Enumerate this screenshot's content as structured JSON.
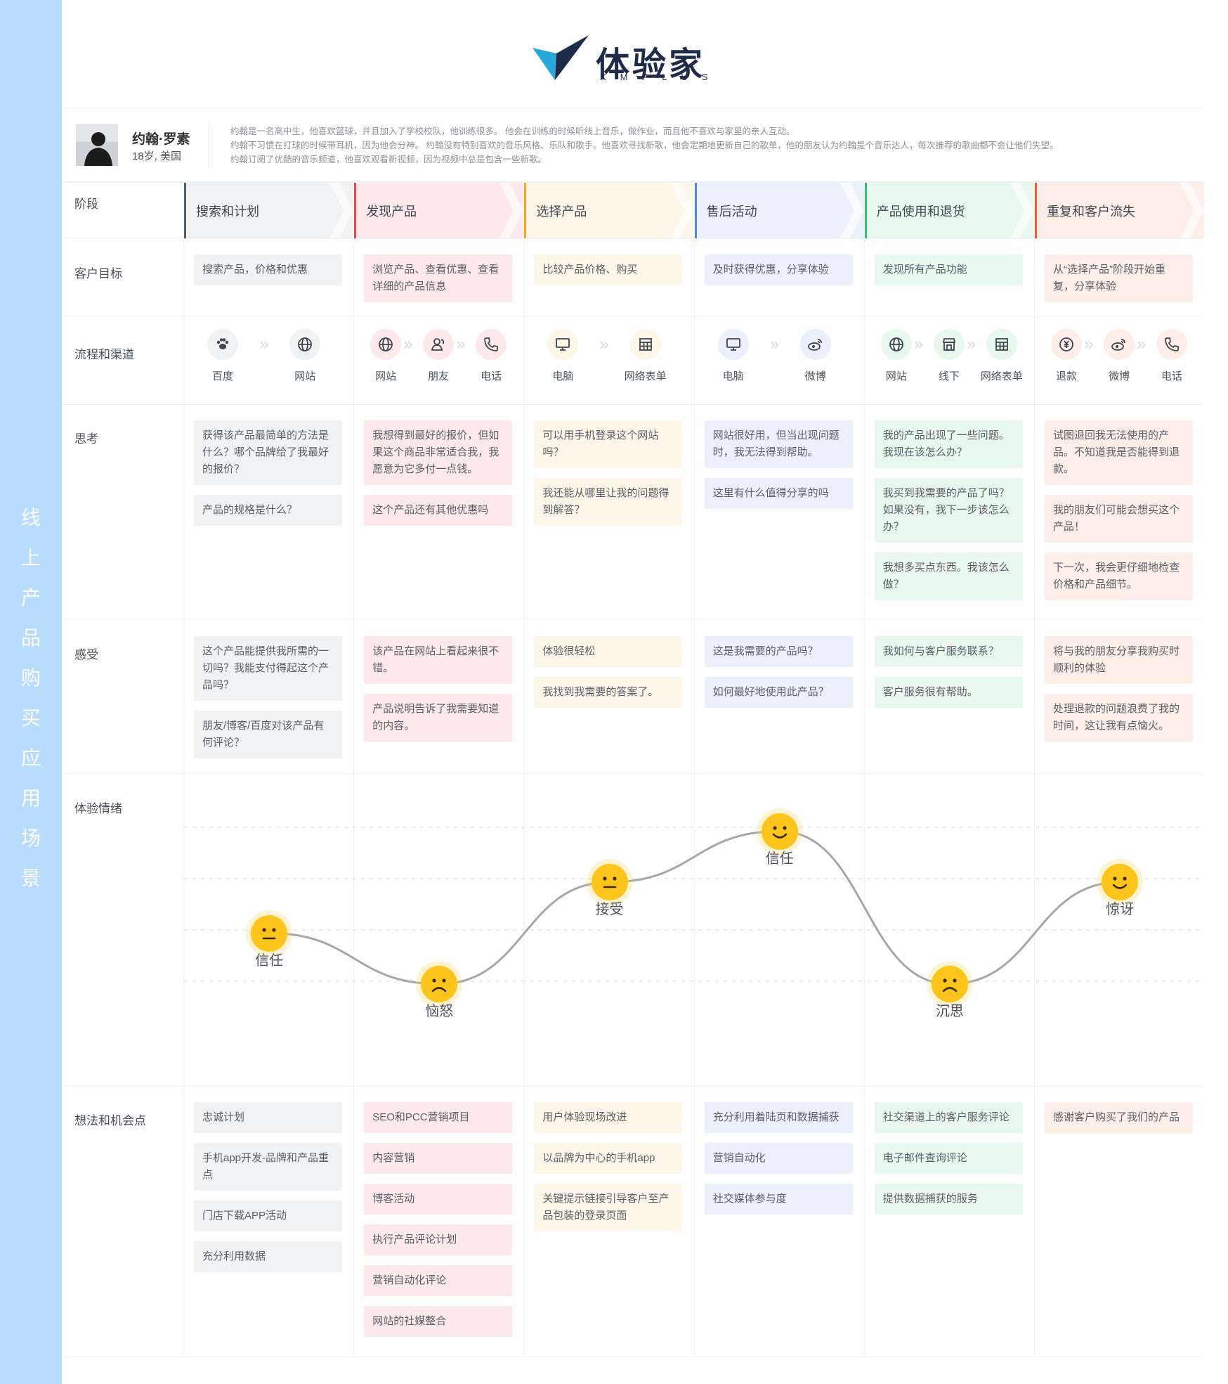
{
  "sidebar_title": [
    "线",
    "上",
    "产",
    "品",
    "购",
    "买",
    "应",
    "用",
    "场",
    "景"
  ],
  "logo": {
    "cn": "体验家",
    "en": "XMPLUS"
  },
  "persona": {
    "name": "约翰·罗素",
    "age": "18岁, 美国",
    "bio": [
      "约翰是一名高中生，他喜欢篮球，并且加入了学校校队，他训练很多。 他会在训练的时候听线上音乐，做作业，而且他不喜欢与家里的亲人互动。",
      "约翰不习惯在打球的时候带耳机，因为他会分神。 约翰没有特别喜欢的音乐风格、乐队和歌手。他喜欢寻找新歌，他会定期地更新自己的歌单，他的朋友认为约翰是个音乐达人，每次推荐的歌曲都不会让他们失望。",
      "约翰订阅了优酷的音乐频道，他喜欢观看新视频，因为视频中总是包含一些新歌。"
    ]
  },
  "row_labels": {
    "stage": "阶段",
    "goal": "客户目标",
    "channel": "流程和渠道",
    "think": "思考",
    "feel": "感受",
    "emotion": "体验情绪",
    "ideas": "想法和机会点"
  },
  "colors": {
    "stage": [
      "#4d5c78",
      "#e24a4f",
      "#f3a72a",
      "#4f86d8",
      "#32c26a",
      "#ec5a36"
    ],
    "icon_bg": [
      "#f1f2f4",
      "#fde8ea",
      "#fdf6e9",
      "#ebf1fc",
      "#e9f8ef",
      "#fdeee8"
    ]
  },
  "stages": [
    {
      "title": "搜索和计划",
      "goal": [
        "搜索产品，价格和优惠"
      ],
      "channels": [
        {
          "icon": "paw-icon",
          "label": "百度"
        },
        {
          "icon": "globe-icon",
          "label": "网站"
        }
      ],
      "think": [
        "获得该产品最简单的方法是什么？哪个品牌给了我最好的报价？",
        "产品的规格是什么？"
      ],
      "feel": [
        "这个产品能提供我所需的一切吗？我能支付得起这个产品吗？",
        "朋友/博客/百度对该产品有何评论？"
      ],
      "ideas": [
        "忠诚计划",
        "手机app开发-品牌和产品重点",
        "门店下载APP活动",
        "充分利用数据"
      ]
    },
    {
      "title": "发现产品",
      "goal": [
        "浏览产品、查看优惠、查看详细的产品信息"
      ],
      "channels": [
        {
          "icon": "globe-icon",
          "label": "网站"
        },
        {
          "icon": "friend-icon",
          "label": "朋友"
        },
        {
          "icon": "phone-icon",
          "label": "电话"
        }
      ],
      "think": [
        "我想得到最好的报价，但如果这个商品非常适合我，我愿意为它多付一点钱。",
        "这个产品还有其他优惠吗"
      ],
      "feel": [
        "该产品在网站上看起来很不错。",
        "产品说明告诉了我需要知道的内容。"
      ],
      "ideas": [
        "SEO和PCC营销项目",
        "内容营销",
        "博客活动",
        "执行产品评论计划",
        "营销自动化评论",
        "网站的社媒整合"
      ]
    },
    {
      "title": "选择产品",
      "goal": [
        "比较产品价格、购买"
      ],
      "channels": [
        {
          "icon": "monitor-icon",
          "label": "电脑"
        },
        {
          "icon": "form-grid-icon",
          "label": "网络表单"
        }
      ],
      "think": [
        "可以用手机登录这个网站吗？",
        "我还能从哪里让我的问题得到解答？"
      ],
      "feel": [
        "体验很轻松",
        "我找到我需要的答案了。"
      ],
      "ideas": [
        "用户体验现场改进",
        "以品牌为中心的手机app",
        "关键提示链接引导客户至产品包装的登录页面"
      ]
    },
    {
      "title": "售后活动",
      "goal": [
        "及时获得优惠，分享体验"
      ],
      "channels": [
        {
          "icon": "monitor-icon",
          "label": "电脑"
        },
        {
          "icon": "weibo-icon",
          "label": "微博"
        }
      ],
      "think": [
        "网站很好用，但当出现问题时，我无法得到帮助。",
        "这里有什么值得分享的吗"
      ],
      "feel": [
        "这是我需要的产品吗？",
        "如何最好地使用此产品？"
      ],
      "ideas": [
        "充分利用着陆页和数据捕获",
        "营销自动化",
        "社交媒体参与度"
      ]
    },
    {
      "title": "产品使用和退货",
      "goal": [
        "发现所有产品功能"
      ],
      "channels": [
        {
          "icon": "globe-icon",
          "label": "网站"
        },
        {
          "icon": "store-icon",
          "label": "线下"
        },
        {
          "icon": "form-grid-icon",
          "label": "网络表单"
        }
      ],
      "think": [
        "我的产品出现了一些问题。我现在该怎么办？",
        "我买到我需要的产品了吗？如果没有，我下一步该怎么办？",
        "我想多买点东西。我该怎么做？"
      ],
      "feel": [
        "我如何与客户服务联系？",
        "客户服务很有帮助。"
      ],
      "ideas": [
        "社交渠道上的客户服务评论",
        "电子邮件查询评论",
        "提供数据捕获的服务"
      ]
    },
    {
      "title": "重复和客户流失",
      "goal": [
        "从“选择产品”阶段开始重复，分享体验"
      ],
      "channels": [
        {
          "icon": "refund-icon",
          "label": "退款"
        },
        {
          "icon": "weibo-icon",
          "label": "微博"
        },
        {
          "icon": "phone-icon",
          "label": "电话"
        }
      ],
      "think": [
        "试图退回我无法使用的产品。不知道我是否能得到退款。",
        "我的朋友们可能会想买这个产品！",
        "下一次，我会更仔细地检查价格和产品细节。"
      ],
      "feel": [
        "将与我的朋友分享我购买时顺利的体验",
        "处理退款的问题浪费了我的时间，这让我有点恼火。"
      ],
      "ideas": [
        "感谢客户购买了我们的产品"
      ]
    }
  ],
  "chart_data": {
    "type": "line",
    "title": "",
    "y_scale": "情绪 (1=消极, 5=积极)",
    "grid": true,
    "series": [
      {
        "x": [
          "搜索和计划",
          "发现产品",
          "选择产品",
          "售后活动",
          "产品使用和退货",
          "重复和客户流失"
        ],
        "values": [
          2,
          1,
          3,
          4,
          1,
          3
        ],
        "labels": [
          "信任",
          "恼怒",
          "接受",
          "信任",
          "沉思",
          "惊讶"
        ],
        "faces": [
          "neutral",
          "sad",
          "neutral",
          "happy",
          "sad",
          "happy"
        ]
      }
    ],
    "ylim": [
      0,
      5
    ]
  }
}
